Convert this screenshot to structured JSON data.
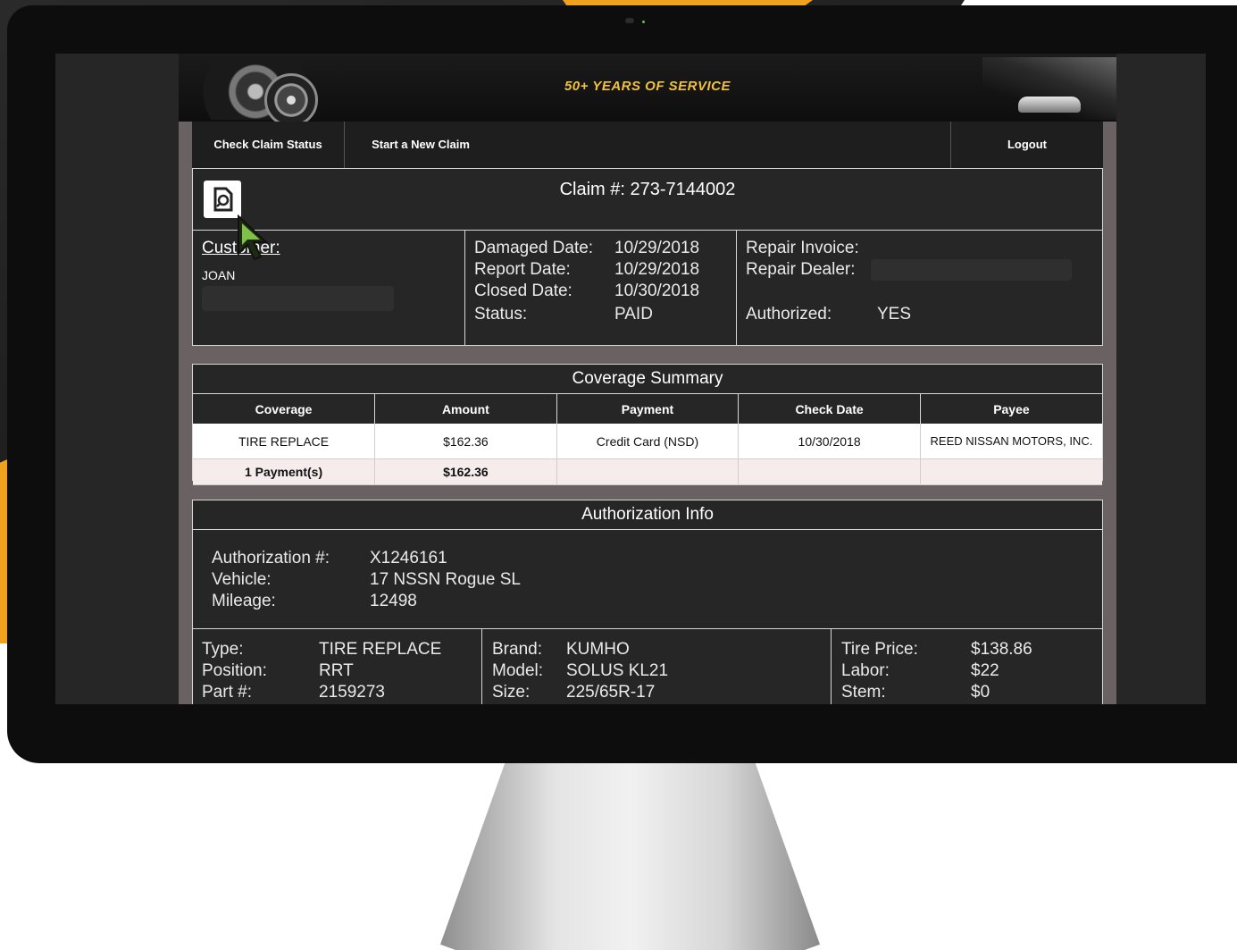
{
  "colors": {
    "accent": "#f0a21f",
    "slogan": "#f2c23a",
    "panel": "#262626",
    "frame": "#6a6262"
  },
  "banner": {
    "slogan": "50+ YEARS OF SERVICE"
  },
  "nav": {
    "check_status": "Check Claim Status",
    "new_claim": "Start a New Claim",
    "logout": "Logout"
  },
  "claim": {
    "title": "Claim #: 273-7144002",
    "doc_icon": "document-search-icon",
    "customer_label": "Customer:",
    "customer_name": "JOAN",
    "damaged_label": "Damaged Date:",
    "damaged_value": "10/29/2018",
    "report_label": "Report Date:",
    "report_value": "10/29/2018",
    "closed_label": "Closed Date:",
    "closed_value": "10/30/2018",
    "status_label": "Status:",
    "status_value": "PAID",
    "repair_invoice_label": "Repair Invoice:",
    "repair_dealer_label": "Repair Dealer:",
    "authorized_label": "Authorized:",
    "authorized_value": "YES"
  },
  "coverage": {
    "title": "Coverage Summary",
    "headers": [
      "Coverage",
      "Amount",
      "Payment",
      "Check Date",
      "Payee"
    ],
    "rows": [
      [
        "TIRE REPLACE",
        "$162.36",
        "Credit Card (NSD)",
        "10/30/2018",
        "REED NISSAN MOTORS, INC."
      ]
    ],
    "total": {
      "label": "1 Payment(s)",
      "amount": "$162.36"
    }
  },
  "authorization": {
    "title": "Authorization Info",
    "auth_label": "Authorization #:",
    "auth_value": "X1246161",
    "vehicle_label": "Vehicle:",
    "vehicle_value": "17 NSSN Rogue SL",
    "mileage_label": "Mileage:",
    "mileage_value": "12498"
  },
  "details": {
    "type_label": "Type:",
    "type_value": "TIRE REPLACE",
    "position_label": "Position:",
    "position_value": "RRT",
    "part_label": "Part #:",
    "part_value": "2159273",
    "brand_label": "Brand:",
    "brand_value": "KUMHO",
    "model_label": "Model:",
    "model_value": "SOLUS KL21",
    "size_label": "Size:",
    "size_value": "225/65R-17",
    "tire_price_label": "Tire Price:",
    "tire_price_value": "$138.86",
    "labor_label": "Labor:",
    "labor_value": "$22",
    "stem_label": "Stem:",
    "stem_value": "$0"
  }
}
